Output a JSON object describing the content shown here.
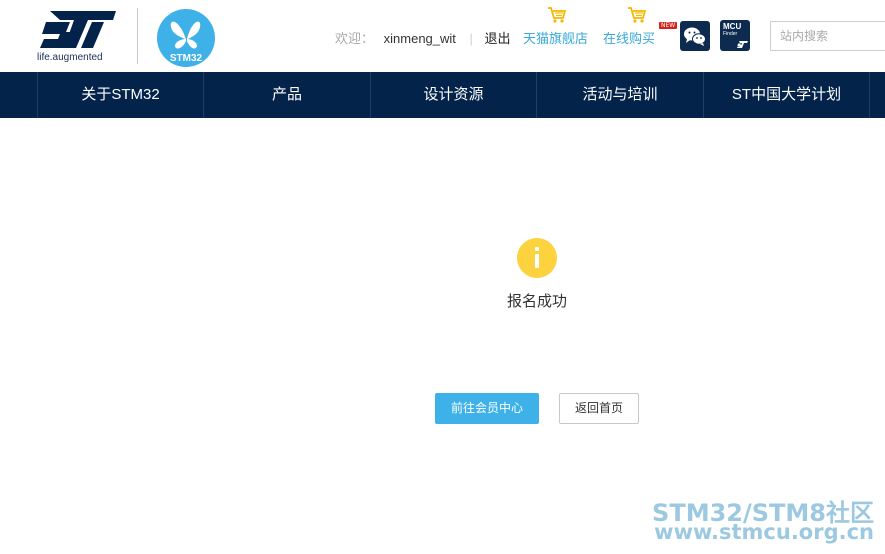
{
  "brand": {
    "st_tagline": "life.augmented",
    "stm32_logo_text": "STM32"
  },
  "header": {
    "welcome_label": "欢迎：",
    "username": "xinmeng_wit",
    "logout_label": "退出",
    "tmall_store_label": "天猫旗舰店",
    "online_shop_label": "在线购买",
    "new_badge": "NEW",
    "mcu_finder": {
      "line1": "MCU",
      "line2": "Finder"
    },
    "search_placeholder": "站内搜索"
  },
  "nav": {
    "items": [
      {
        "label": "关于STM32"
      },
      {
        "label": "产品"
      },
      {
        "label": "设计资源"
      },
      {
        "label": "活动与培训"
      },
      {
        "label": "ST中国大学计划"
      }
    ]
  },
  "main": {
    "status_icon": "info-icon",
    "message": "报名成功",
    "primary_button": "前往会员中心",
    "secondary_button": "返回首页"
  },
  "watermark": {
    "line1": "STM32/STM8社区",
    "line2": "www.stmcu.org.cn"
  },
  "colors": {
    "nav_bg": "#03234b",
    "accent_blue": "#3eb2e8",
    "icon_yellow": "#fcd23f",
    "link_blue": "#3aa8d8"
  }
}
